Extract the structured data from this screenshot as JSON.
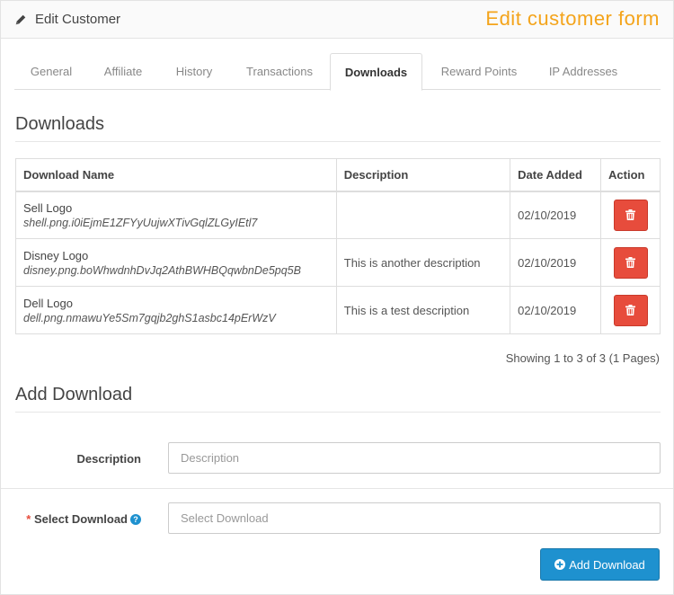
{
  "header": {
    "title": "Edit Customer",
    "annotation": "Edit customer form",
    "icon": "pencil-icon"
  },
  "tabs": [
    {
      "label": "General",
      "active": false
    },
    {
      "label": "Affiliate",
      "active": false
    },
    {
      "label": "History",
      "active": false
    },
    {
      "label": "Transactions",
      "active": false
    },
    {
      "label": "Downloads",
      "active": true
    },
    {
      "label": "Reward Points",
      "active": false
    },
    {
      "label": "IP Addresses",
      "active": false
    }
  ],
  "downloads_section": {
    "title": "Downloads",
    "columns": [
      "Download Name",
      "Description",
      "Date Added",
      "Action"
    ],
    "rows": [
      {
        "name": "Sell Logo",
        "file": "shell.png.i0iEjmE1ZFYyUujwXTivGqlZLGyIEtl7",
        "description": "",
        "date_added": "02/10/2019",
        "action_icon": "trash-icon"
      },
      {
        "name": "Disney Logo",
        "file": "disney.png.boWhwdnhDvJq2AthBWHBQqwbnDe5pq5B",
        "description": "This is another description",
        "date_added": "02/10/2019",
        "action_icon": "trash-icon"
      },
      {
        "name": "Dell Logo",
        "file": "dell.png.nmawuYe5Sm7gqjb2ghS1asbc14pErWzV",
        "description": "This is a test description",
        "date_added": "02/10/2019",
        "action_icon": "trash-icon"
      }
    ],
    "pagination": "Showing 1 to 3 of 3 (1 Pages)"
  },
  "add_section": {
    "title": "Add Download",
    "description_label": "Description",
    "description_placeholder": "Description",
    "description_value": "",
    "select_label": "Select Download",
    "select_required": "*",
    "select_help": "?",
    "select_placeholder": "Select Download",
    "select_value": "",
    "submit_label": "Add Download"
  },
  "colors": {
    "accent": "#1e91cf",
    "danger": "#e74c3c",
    "annotation": "#f4a41b"
  }
}
